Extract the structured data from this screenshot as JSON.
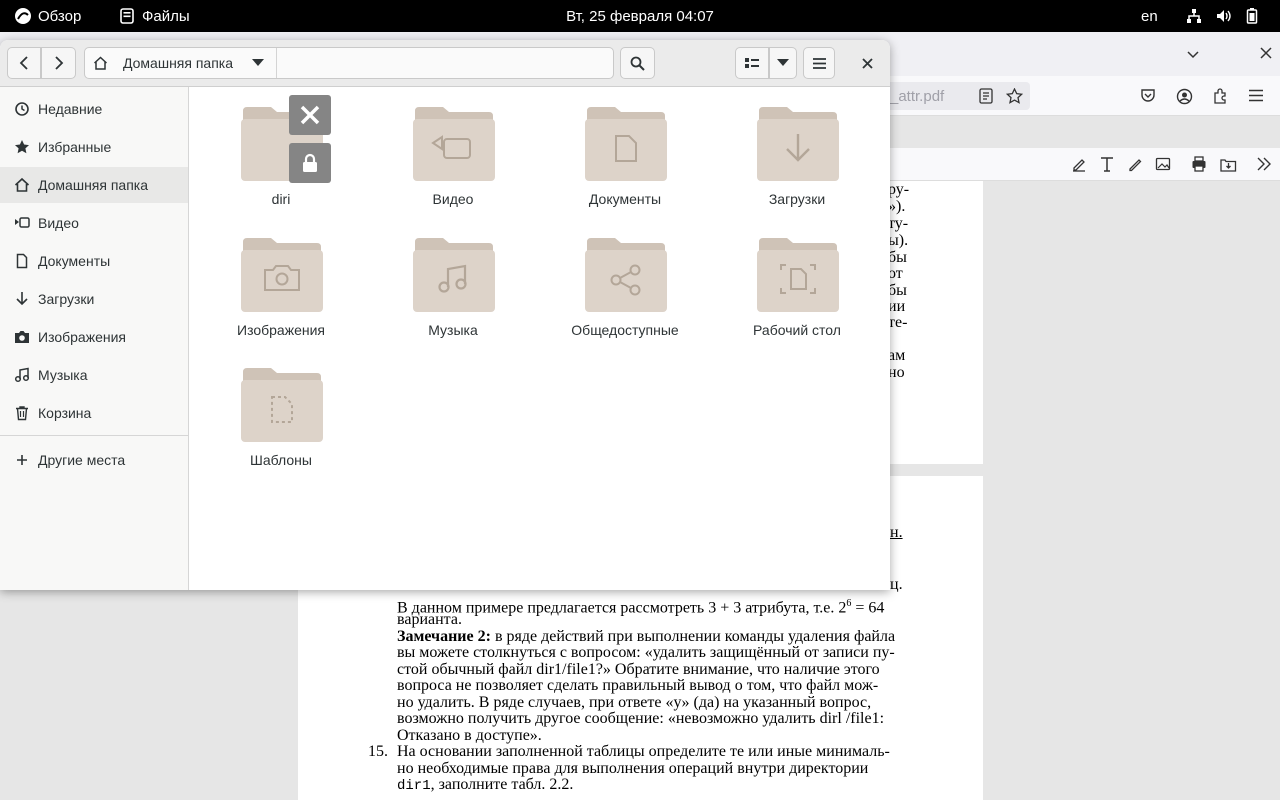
{
  "topbar": {
    "activities": "Обзор",
    "app_name": "Файлы",
    "clock": "Вт, 25 февраля  04:07",
    "language": "en",
    "tray_icons": [
      "network-icon",
      "volume-icon",
      "battery-icon"
    ]
  },
  "browser": {
    "url_fragment": "_attr.pdf",
    "pdf_page1_lines": [
      "ру-",
      "»).",
      "ту-",
      "ы).",
      "бы",
      "от",
      "бы",
      "ии",
      "те-",
      "ам",
      "но"
    ],
    "pdf_page2": {
      "line_cut": "н.",
      "line_cut2": "ц.",
      "l1": "В данном примере предлагается рассмотреть 3 + 3 атрибута, т.е. 2",
      "l1_sup": "6",
      "l1_end": " = 64",
      "l2": "варианта.",
      "l3_bold": "Замечание 2:",
      "l3": " в ряде действий при выполнении команды удаления файла",
      "l4": "вы можете столкнуться с вопросом: «удалить защищённый от записи пу-",
      "l5": "стой обычный файл dir1/file1?» Обратите внимание, что наличие этого",
      "l6": "вопроса не позволяет сделать правильный вывод о том, что файл мож-",
      "l7": "но удалить. В ряде случаев, при ответе «y» (да) на указанный вопрос,",
      "l8": "возможно получить другое сообщение: «невозможно удалить dirl /file1:",
      "l9": "Отказано в доступе».",
      "num15": "15.",
      "l10": "На основании заполненной таблицы определите те или иные минималь-",
      "l11": "но необходимые права для выполнения операций внутри директории",
      "l12_mono": "dir1",
      "l12": ", заполните табл. 2.2."
    }
  },
  "filemanager": {
    "path_current": "Домашняя папка",
    "sidebar": [
      {
        "label": "Недавние",
        "icon": "clock-icon"
      },
      {
        "label": "Избранные",
        "icon": "star-icon"
      },
      {
        "label": "Домашняя папка",
        "icon": "home-icon"
      },
      {
        "label": "Видео",
        "icon": "video-icon"
      },
      {
        "label": "Документы",
        "icon": "document-icon"
      },
      {
        "label": "Загрузки",
        "icon": "download-icon"
      },
      {
        "label": "Изображения",
        "icon": "camera-icon"
      },
      {
        "label": "Музыка",
        "icon": "music-icon"
      },
      {
        "label": "Корзина",
        "icon": "trash-icon"
      },
      {
        "label": "Другие места",
        "icon": "plus-icon"
      }
    ],
    "items": [
      {
        "name": "diri",
        "icon": "locked-folder-icon"
      },
      {
        "name": "Видео",
        "icon": "video-folder-icon"
      },
      {
        "name": "Документы",
        "icon": "documents-folder-icon"
      },
      {
        "name": "Загрузки",
        "icon": "downloads-folder-icon"
      },
      {
        "name": "Изображения",
        "icon": "pictures-folder-icon"
      },
      {
        "name": "Музыка",
        "icon": "music-folder-icon"
      },
      {
        "name": "Общедоступные",
        "icon": "public-share-folder-icon"
      },
      {
        "name": "Рабочий стол",
        "icon": "desktop-folder-icon"
      },
      {
        "name": "Шаблоны",
        "icon": "templates-folder-icon"
      }
    ]
  }
}
